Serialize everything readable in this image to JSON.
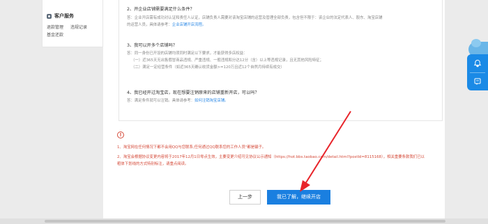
{
  "sidebar": {
    "section_title": "客户服务",
    "items": [
      "退款管理",
      "违规记录",
      "基金还款"
    ]
  },
  "faq": [
    {
      "question": "2、开企业店铺需要满足什么条件？",
      "answer_lines": [
        "答：企业开店需有成功对认证和责任人认证，店铺负责人需要对该淘宝店铺的运营及管理全部负责，包含但不限于：该企业的法定代表人、股东、淘宝店铺",
        "的运营人员，具体请参考：{link}"
      ],
      "link": "企业店铺开店流程。"
    },
    {
      "question": "3、我可以开多个店铺吗？",
      "answer_lines": [
        "答：同一身份已开设的店铺均须同时满足以下要求，才能获得多店权益：",
        "（一）近365天无出售假冒商品违规、严重违规、一般违规和分达12分（含）以上等违规记录，且无其他风险特征；",
        "（二）满足一定经营条件（如近365天确认收货金额>=120万且近12个自然月持续有成交）"
      ]
    },
    {
      "question": "4、我已经开过淘宝店，现在想要注销原来的店铺重新开店，可以吗？",
      "answer_lines": [
        "答：满足条件就可以注销。具体请参考：{link}"
      ],
      "link": "如何注销淘宝店铺。"
    }
  ],
  "notices": [
    "1、淘宝网在任何情况下都不会用QQ与您联系,任何通过QQ联系您的工作人员\"都是骗子。",
    "2、淘宝会根据协议变更内容将于2017年12月1日零点生效，主要变更介绍可见协议公示通知（https://hot.bbs.taobao.com/detail.html?postId=8115168），相关重要条款我们已以",
    "粗体下划线的方式特别标注，请重点阅读。"
  ],
  "buttons": {
    "prev": "上一步",
    "next": "我已了解，继续开店"
  },
  "colors": {
    "accent": "#1a7fe0",
    "warning": "#d54b3a",
    "link": "#2e8ae6",
    "annotation_arrow": "#e8242a"
  },
  "icons": {
    "sidebar_section": "customer-service-icon",
    "notice": "exclamation-circle-icon",
    "widget_top": "bell-icon",
    "widget_bottom": "feedback-icon"
  }
}
